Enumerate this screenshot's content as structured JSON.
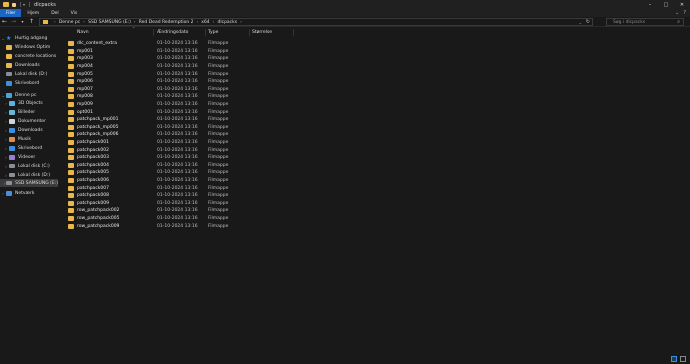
{
  "window": {
    "title": "dlcpacks"
  },
  "ribbon": {
    "tabs": [
      "Filer",
      "Hjem",
      "Del",
      "Vis"
    ]
  },
  "address": {
    "crumbs": [
      "Denne pc",
      "SSD SAMSUNG (E:)",
      "Red Dead Redemption 2",
      "x64",
      "dlcpacks"
    ]
  },
  "search": {
    "placeholder": "Søg i dlcpacks"
  },
  "sidebar": {
    "items": [
      {
        "label": "Hurtig adgang",
        "icon": "star-icon"
      },
      {
        "label": "Windows Optim",
        "icon": "folder-icon"
      },
      {
        "label": "concrete locations",
        "icon": "folder-icon"
      },
      {
        "label": "Downloads",
        "icon": "folder-icon"
      },
      {
        "label": "Lokal disk (D:)",
        "icon": "drive-icon"
      },
      {
        "label": "Skrivebord",
        "icon": "desktop-icon"
      },
      {
        "label": "Denne pc",
        "icon": "pc-icon"
      },
      {
        "label": "3D Objects",
        "icon": "objects-icon"
      },
      {
        "label": "Billeder",
        "icon": "images-icon"
      },
      {
        "label": "Dokumenter",
        "icon": "documents-icon"
      },
      {
        "label": "Downloads",
        "icon": "downloads-icon"
      },
      {
        "label": "Musik",
        "icon": "music-icon"
      },
      {
        "label": "Skrivebord",
        "icon": "desktop-icon"
      },
      {
        "label": "Videoer",
        "icon": "video-icon"
      },
      {
        "label": "Lokal disk (C:)",
        "icon": "drive-icon"
      },
      {
        "label": "Lokal disk (D:)",
        "icon": "drive-icon"
      },
      {
        "label": "SSD SAMSUNG (E:)",
        "icon": "drive-icon"
      },
      {
        "label": "Netværk",
        "icon": "network-icon"
      }
    ]
  },
  "columns": {
    "name": "Navn",
    "date": "Ændringsdato",
    "type": "Type",
    "size": "Størrelse"
  },
  "files": [
    {
      "name": "dlc_content_extra",
      "date": "01-10-2024 13:16",
      "type": "Filmappe"
    },
    {
      "name": "mp001",
      "date": "01-10-2024 13:16",
      "type": "Filmappe"
    },
    {
      "name": "mp003",
      "date": "01-10-2024 13:16",
      "type": "Filmappe"
    },
    {
      "name": "mp004",
      "date": "01-10-2024 13:16",
      "type": "Filmappe"
    },
    {
      "name": "mp005",
      "date": "01-10-2024 13:16",
      "type": "Filmappe"
    },
    {
      "name": "mp006",
      "date": "01-10-2024 13:16",
      "type": "Filmappe"
    },
    {
      "name": "mp007",
      "date": "01-10-2024 13:16",
      "type": "Filmappe"
    },
    {
      "name": "mp008",
      "date": "01-10-2024 13:16",
      "type": "Filmappe"
    },
    {
      "name": "mp009",
      "date": "01-10-2024 13:16",
      "type": "Filmappe"
    },
    {
      "name": "opt001",
      "date": "01-10-2024 13:16",
      "type": "Filmappe"
    },
    {
      "name": "patchpack_mp001",
      "date": "01-10-2024 13:16",
      "type": "Filmappe"
    },
    {
      "name": "patchpack_mp005",
      "date": "01-10-2024 13:16",
      "type": "Filmappe"
    },
    {
      "name": "patchpack_mp006",
      "date": "01-10-2024 13:16",
      "type": "Filmappe"
    },
    {
      "name": "patchpack001",
      "date": "01-10-2024 13:16",
      "type": "Filmappe"
    },
    {
      "name": "patchpack002",
      "date": "01-10-2024 13:16",
      "type": "Filmappe"
    },
    {
      "name": "patchpack003",
      "date": "01-10-2024 13:16",
      "type": "Filmappe"
    },
    {
      "name": "patchpack004",
      "date": "01-10-2024 13:16",
      "type": "Filmappe"
    },
    {
      "name": "patchpack005",
      "date": "01-10-2024 13:16",
      "type": "Filmappe"
    },
    {
      "name": "patchpack006",
      "date": "01-10-2024 13:16",
      "type": "Filmappe"
    },
    {
      "name": "patchpack007",
      "date": "01-10-2024 13:16",
      "type": "Filmappe"
    },
    {
      "name": "patchpack008",
      "date": "01-10-2024 13:16",
      "type": "Filmappe"
    },
    {
      "name": "patchpack009",
      "date": "01-10-2024 13:16",
      "type": "Filmappe"
    },
    {
      "name": "row_patchpack002",
      "date": "01-10-2024 13:16",
      "type": "Filmappe"
    },
    {
      "name": "row_patchpack005",
      "date": "01-10-2024 13:16",
      "type": "Filmappe"
    },
    {
      "name": "row_patchpack009",
      "date": "01-10-2024 13:16",
      "type": "Filmappe"
    }
  ],
  "colors": {
    "accent": "#1a66c4",
    "folder": "#e8b94a",
    "background": "#191919"
  }
}
